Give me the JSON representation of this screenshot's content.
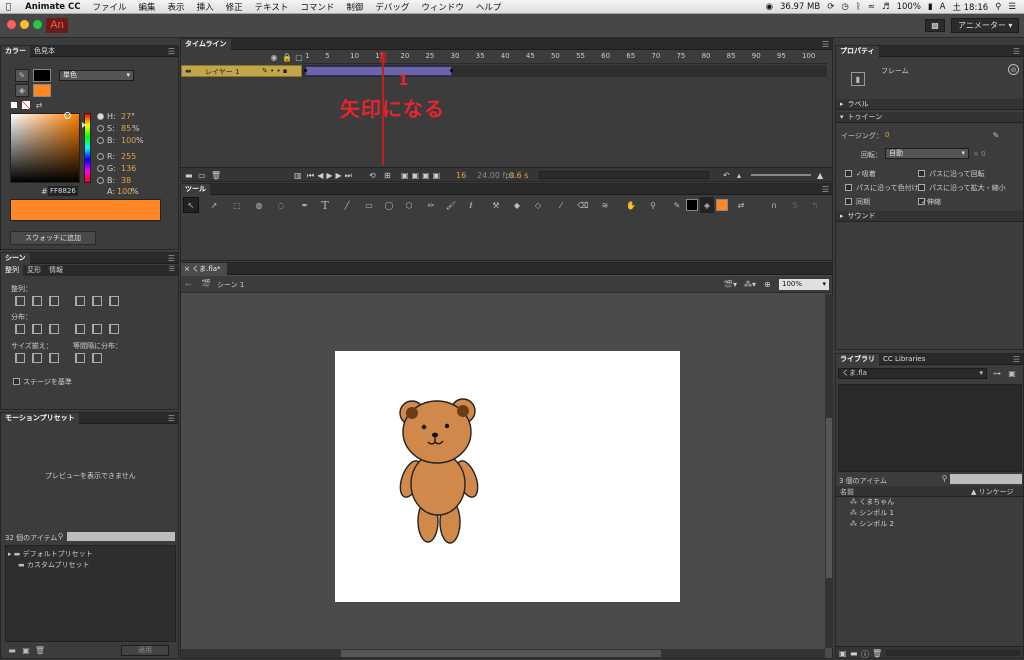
{
  "menubar": {
    "app": "Animate CC",
    "items": [
      "ファイル",
      "編集",
      "表示",
      "挿入",
      "修正",
      "テキスト",
      "コマンド",
      "制御",
      "デバッグ",
      "ウィンドウ",
      "ヘルプ"
    ],
    "memory": "36.97 MB",
    "battery": "100%",
    "clock": "土 18:16"
  },
  "titlebar": {
    "logo": "An",
    "workspace": "アニメーター"
  },
  "color_panel": {
    "tabs": [
      "カラー",
      "色見本"
    ],
    "fill_type": "単色",
    "H": "27",
    "H_unit": "°",
    "S": "85",
    "S_unit": "%",
    "B": "100",
    "B_unit": "%",
    "R": "255",
    "G": "136",
    "Bv": "38",
    "hex_label": "#",
    "hex": "FF8826",
    "alpha_label": "A:",
    "alpha": "100",
    "alpha_unit": "%",
    "add_swatch": "スウォッチに追加",
    "swatch_color": "#ff8826"
  },
  "align_panel": {
    "tabs": [
      "シーン",
      "整列",
      "変形",
      "情報"
    ],
    "align_label": "整列：",
    "distribute_label": "分布：",
    "match_size_label": "サイズ揃え：",
    "space_label": "等間隔に分布：",
    "stage_label": "ステージを基準"
  },
  "motion_presets": {
    "title": "モーションプリセット",
    "preview": "プレビューを表示できません",
    "count": "32 個のアイテム",
    "folders": [
      "デフォルトプリセット",
      "カスタムプリセット"
    ],
    "apply": "適用"
  },
  "timeline": {
    "title": "タイムライン",
    "layer": "レイヤー 1",
    "frame_numbers": [
      "1",
      "5",
      "10",
      "15",
      "20",
      "25",
      "30",
      "35",
      "40",
      "45",
      "50",
      "55",
      "60",
      "65",
      "70",
      "75",
      "80",
      "85",
      "90",
      "95",
      "100"
    ],
    "current_frame": "16",
    "fps": "24.00 fps",
    "time": "0.6 s",
    "annotation_number": "1",
    "annotation_text": "矢印になる"
  },
  "tools": {
    "title": "ツール"
  },
  "stage": {
    "tab": "くま.fla*",
    "scene": "シーン 1",
    "zoom": "100%"
  },
  "properties": {
    "title": "プロパティ",
    "type": "フレーム",
    "sec_label": "ラベル",
    "sec_tween": "トゥイーン",
    "easing_label": "イージング：",
    "easing_value": "0",
    "rotate_label": "回転：",
    "rotate_value": "自動",
    "rotate_count": "× 0",
    "cb_snap": "吸着",
    "cb_orient": "パスに沿って回転",
    "cb_color": "パスに沿って色付け",
    "cb_scale_path": "パスに沿って拡大・縮小",
    "cb_sync": "同期",
    "cb_scale": "伸縮",
    "sec_sound": "サウンド"
  },
  "library": {
    "tabs": [
      "ライブラリ",
      "CC Libraries"
    ],
    "file": "くま.fla",
    "count": "3 個のアイテム",
    "col_name": "名前",
    "col_linkage": "リンケージ",
    "items": [
      "くまちゃん",
      "シンボル 1",
      "シンボル 2"
    ]
  }
}
